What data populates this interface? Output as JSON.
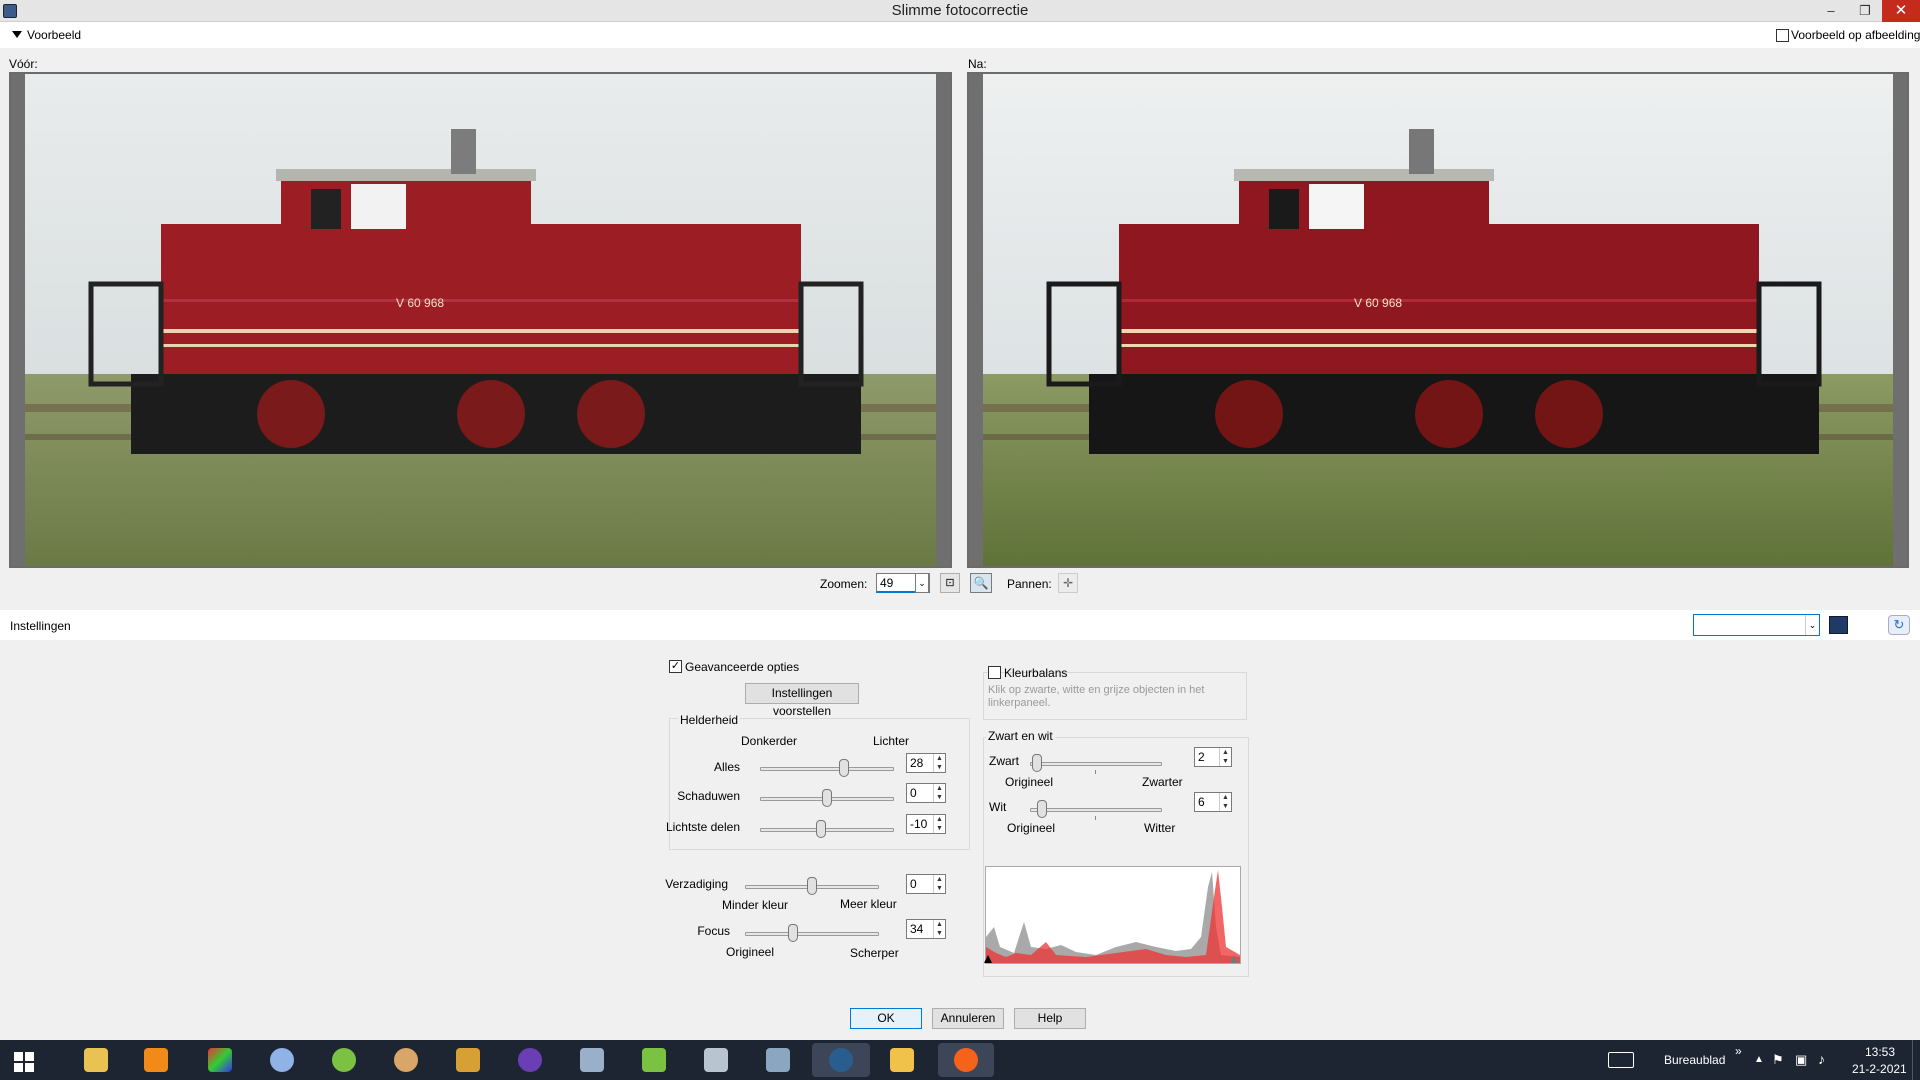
{
  "window": {
    "title": "Slimme fotocorrectie",
    "minimize": "–",
    "restore": "❐",
    "close": "✕"
  },
  "preview": {
    "section_label": "Voorbeeld",
    "preview_on_image_label": "Voorbeeld op afbeelding",
    "before_label": "Vóór:",
    "after_label": "Na:",
    "loco_number": "V 60 968"
  },
  "zoom": {
    "label": "Zoomen:",
    "value": "49",
    "pan_label": "Pannen:"
  },
  "settings": {
    "label": "Instellingen",
    "preset_value": ""
  },
  "advanced": {
    "label": "Geavanceerde opties",
    "checked": true,
    "suggest_button": "Instellingen voorstellen"
  },
  "brightness": {
    "group_label": "Helderheid",
    "darker": "Donkerder",
    "lighter": "Lichter",
    "all": {
      "label": "Alles",
      "value": "28",
      "level": 0.64
    },
    "shadows": {
      "label": "Schaduwen",
      "value": "0",
      "level": 0.5
    },
    "highlights": {
      "label": "Lichtste delen",
      "value": "-10",
      "level": 0.45
    }
  },
  "saturation": {
    "label": "Verzadiging",
    "value": "0",
    "level": 0.5,
    "min_label": "Minder kleur",
    "max_label": "Meer kleur"
  },
  "focus": {
    "label": "Focus",
    "value": "34",
    "level": 0.35,
    "min_label": "Origineel",
    "max_label": "Scherper"
  },
  "color_balance": {
    "label": "Kleurbalans",
    "checked": false,
    "hint": "Klik op zwarte, witte en grijze objecten in het linkerpaneel."
  },
  "black_white": {
    "group_label": "Zwart en wit",
    "black": {
      "label": "Zwart",
      "value": "2",
      "level": 0.02,
      "min_label": "Origineel",
      "max_label": "Zwarter"
    },
    "white": {
      "label": "Wit",
      "value": "6",
      "level": 0.06,
      "min_label": "Origineel",
      "max_label": "Witter"
    }
  },
  "buttons": {
    "ok": "OK",
    "cancel": "Annuleren",
    "help": "Help"
  },
  "taskbar": {
    "desktop_label": "Bureaublad",
    "chevron": "»",
    "time": "13:53",
    "date": "21-2-2021",
    "colors": {
      "bg": "#1e2532",
      "accent": "#0078d7",
      "close": "#c42b1c"
    }
  }
}
